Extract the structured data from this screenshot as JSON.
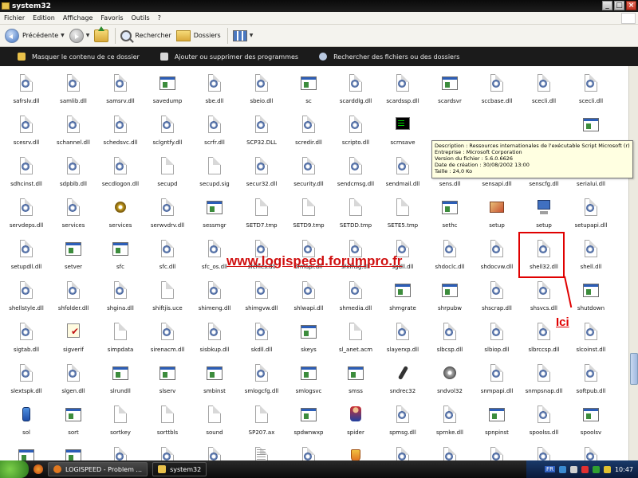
{
  "window": {
    "title": "system32"
  },
  "menu": [
    "Fichier",
    "Edition",
    "Affichage",
    "Favoris",
    "Outils",
    "?"
  ],
  "toolbar": {
    "back_label": "Précédente",
    "search_label": "Rechercher",
    "folders_label": "Dossiers"
  },
  "tasks": [
    {
      "label": "Masquer le contenu de ce dossier",
      "icon": "hide-folder-icon"
    },
    {
      "label": "Ajouter ou supprimer des programmes",
      "icon": "add-remove-programs-icon"
    },
    {
      "label": "Rechercher des fichiers ou des dossiers",
      "icon": "search-icon"
    }
  ],
  "tooltip": {
    "lines": [
      "Description : Ressources internationales de l'exécutable Script Microsoft (r)",
      "Entreprise : Microsoft Corporation",
      "Version du fichier : 5.6.0.6626",
      "Date de création : 30/08/2002 13:00",
      "Taille : 24,0 Ko"
    ]
  },
  "annotation": {
    "watermark": "www.logispeed.forumpro.fr",
    "pointer_label": "Ici"
  },
  "files": [
    [
      {
        "name": "safrslv.dll",
        "icon": "dll"
      },
      {
        "name": "samlib.dll",
        "icon": "dll"
      },
      {
        "name": "samsrv.dll",
        "icon": "dll"
      },
      {
        "name": "savedump",
        "icon": "app"
      },
      {
        "name": "sbe.dll",
        "icon": "dll"
      },
      {
        "name": "sbeio.dll",
        "icon": "dll"
      },
      {
        "name": "sc",
        "icon": "app"
      },
      {
        "name": "scarddlg.dll",
        "icon": "dll"
      },
      {
        "name": "scardssp.dll",
        "icon": "dll"
      },
      {
        "name": "scardsvr",
        "icon": "app"
      },
      {
        "name": "sccbase.dll",
        "icon": "dll"
      },
      {
        "name": "scecli.dll",
        "icon": "dll"
      },
      {
        "name": "scecli.dll",
        "icon": "dll"
      }
    ],
    [
      {
        "name": "scesrv.dll",
        "icon": "dll"
      },
      {
        "name": "schannel.dll",
        "icon": "dll"
      },
      {
        "name": "schedsvc.dll",
        "icon": "dll"
      },
      {
        "name": "sclgntfy.dll",
        "icon": "dll"
      },
      {
        "name": "scrfr.dll",
        "icon": "dll"
      },
      {
        "name": "SCP32.DLL",
        "icon": "dll"
      },
      {
        "name": "scredir.dll",
        "icon": "dll"
      },
      {
        "name": "scripto.dll",
        "icon": "dll"
      },
      {
        "name": "scrnsave",
        "icon": "cmd"
      },
      {
        "name": "",
        "icon": "none"
      },
      {
        "name": "",
        "icon": "none"
      },
      {
        "name": "",
        "icon": "none"
      },
      {
        "name": "",
        "icon": "app"
      }
    ],
    [
      {
        "name": "sdhcinst.dll",
        "icon": "dll"
      },
      {
        "name": "sdpblb.dll",
        "icon": "dll"
      },
      {
        "name": "secdlogon.dll",
        "icon": "dll"
      },
      {
        "name": "secupd",
        "icon": "blank"
      },
      {
        "name": "secupd.sig",
        "icon": "blank"
      },
      {
        "name": "secur32.dll",
        "icon": "dll"
      },
      {
        "name": "security.dll",
        "icon": "dll"
      },
      {
        "name": "sendcmsg.dll",
        "icon": "dll"
      },
      {
        "name": "sendmail.dll",
        "icon": "dll"
      },
      {
        "name": "sens.dll",
        "icon": "dll"
      },
      {
        "name": "sensapi.dll",
        "icon": "dll"
      },
      {
        "name": "senscfg.dll",
        "icon": "dll"
      },
      {
        "name": "serialui.dll",
        "icon": "dll"
      }
    ],
    [
      {
        "name": "servdeps.dll",
        "icon": "dll"
      },
      {
        "name": "services",
        "icon": "dll"
      },
      {
        "name": "services",
        "icon": "gearapp"
      },
      {
        "name": "serwvdrv.dll",
        "icon": "dll"
      },
      {
        "name": "sessmgr",
        "icon": "app"
      },
      {
        "name": "SETD7.tmp",
        "icon": "blank"
      },
      {
        "name": "SETD9.tmp",
        "icon": "blank"
      },
      {
        "name": "SETDD.tmp",
        "icon": "blank"
      },
      {
        "name": "SETE5.tmp",
        "icon": "blank"
      },
      {
        "name": "sethc",
        "icon": "app"
      },
      {
        "name": "setup",
        "icon": "picture"
      },
      {
        "name": "setup",
        "icon": "computer"
      },
      {
        "name": "setupapi.dll",
        "icon": "dll"
      }
    ],
    [
      {
        "name": "setupdll.dll",
        "icon": "dll"
      },
      {
        "name": "setver",
        "icon": "app"
      },
      {
        "name": "sfc",
        "icon": "app"
      },
      {
        "name": "sfc.dll",
        "icon": "dll"
      },
      {
        "name": "sfc_os.dll",
        "icon": "dll"
      },
      {
        "name": "sfcfiles.dll",
        "icon": "dll"
      },
      {
        "name": "sfmapi.dll",
        "icon": "dll"
      },
      {
        "name": "sfxmsg.dll",
        "icon": "dll"
      },
      {
        "name": "sgdll.dll",
        "icon": "dll"
      },
      {
        "name": "shdoclc.dll",
        "icon": "dll"
      },
      {
        "name": "shdocvw.dll",
        "icon": "dll"
      },
      {
        "name": "shell32.dll",
        "icon": "dll"
      },
      {
        "name": "shell.dll",
        "icon": "dll"
      }
    ],
    [
      {
        "name": "shellstyle.dll",
        "icon": "dll"
      },
      {
        "name": "shfolder.dll",
        "icon": "dll"
      },
      {
        "name": "shgina.dll",
        "icon": "dll"
      },
      {
        "name": "shiftjis.uce",
        "icon": "blank"
      },
      {
        "name": "shimeng.dll",
        "icon": "dll"
      },
      {
        "name": "shimgvw.dll",
        "icon": "dll"
      },
      {
        "name": "shlwapi.dll",
        "icon": "dll"
      },
      {
        "name": "shmedia.dll",
        "icon": "dll"
      },
      {
        "name": "shmgrate",
        "icon": "app"
      },
      {
        "name": "shrpubw",
        "icon": "app"
      },
      {
        "name": "shscrap.dll",
        "icon": "dll"
      },
      {
        "name": "shsvcs.dll",
        "icon": "dll"
      },
      {
        "name": "shutdown",
        "icon": "app"
      }
    ],
    [
      {
        "name": "sigtab.dll",
        "icon": "dll"
      },
      {
        "name": "sigverif",
        "icon": "checklist"
      },
      {
        "name": "simpdata",
        "icon": "blank"
      },
      {
        "name": "sirenacm.dll",
        "icon": "dll"
      },
      {
        "name": "sisbkup.dll",
        "icon": "dll"
      },
      {
        "name": "skdll.dll",
        "icon": "dll"
      },
      {
        "name": "skeys",
        "icon": "app"
      },
      {
        "name": "sl_anet.acm",
        "icon": "blank"
      },
      {
        "name": "slayerxp.dll",
        "icon": "dll"
      },
      {
        "name": "slbcsp.dll",
        "icon": "dll"
      },
      {
        "name": "slbiop.dll",
        "icon": "dll"
      },
      {
        "name": "slbrccsp.dll",
        "icon": "dll"
      },
      {
        "name": "slcoinst.dll",
        "icon": "dll"
      }
    ],
    [
      {
        "name": "slextspk.dll",
        "icon": "dll"
      },
      {
        "name": "slgen.dll",
        "icon": "dll"
      },
      {
        "name": "slrundll",
        "icon": "app"
      },
      {
        "name": "slserv",
        "icon": "app"
      },
      {
        "name": "smbinst",
        "icon": "app"
      },
      {
        "name": "smlogcfg.dll",
        "icon": "dll"
      },
      {
        "name": "smlogsvc",
        "icon": "app"
      },
      {
        "name": "smss",
        "icon": "app"
      },
      {
        "name": "sndrec32",
        "icon": "mic"
      },
      {
        "name": "sndvol32",
        "icon": "speaker"
      },
      {
        "name": "snmpapi.dll",
        "icon": "dll"
      },
      {
        "name": "snmpsnap.dll",
        "icon": "dll"
      },
      {
        "name": "softpub.dll",
        "icon": "dll"
      }
    ],
    [
      {
        "name": "sol",
        "icon": "bottle"
      },
      {
        "name": "sort",
        "icon": "app"
      },
      {
        "name": "sortkey",
        "icon": "blank"
      },
      {
        "name": "sorttbls",
        "icon": "blank"
      },
      {
        "name": "sound",
        "icon": "blank"
      },
      {
        "name": "SP207.ax",
        "icon": "blank"
      },
      {
        "name": "spdwnwxp",
        "icon": "app"
      },
      {
        "name": "spider",
        "icon": "person"
      },
      {
        "name": "spmsg.dll",
        "icon": "dll"
      },
      {
        "name": "sprnke.dll",
        "icon": "dll"
      },
      {
        "name": "spnpinst",
        "icon": "app"
      },
      {
        "name": "spoolss.dll",
        "icon": "dll"
      },
      {
        "name": "spoolsv",
        "icon": "app"
      }
    ],
    [
      {
        "name": "",
        "icon": "app"
      },
      {
        "name": "",
        "icon": "app"
      },
      {
        "name": "",
        "icon": "dll"
      },
      {
        "name": "",
        "icon": "dll"
      },
      {
        "name": "",
        "icon": "dll"
      },
      {
        "name": "",
        "icon": "doc"
      },
      {
        "name": "",
        "icon": "dll"
      },
      {
        "name": "",
        "icon": "shield"
      },
      {
        "name": "",
        "icon": "dll"
      },
      {
        "name": "",
        "icon": "dll"
      },
      {
        "name": "",
        "icon": "dll"
      },
      {
        "name": "",
        "icon": "dll"
      },
      {
        "name": "",
        "icon": "dll"
      }
    ]
  ],
  "taskbar": {
    "buttons": [
      {
        "label": "LOGISPEED - Problem ...",
        "icon": "firefox-icon",
        "active": false
      },
      {
        "label": "system32",
        "icon": "folder-icon",
        "active": true
      }
    ],
    "lang": "FR",
    "clock": "10:47"
  }
}
